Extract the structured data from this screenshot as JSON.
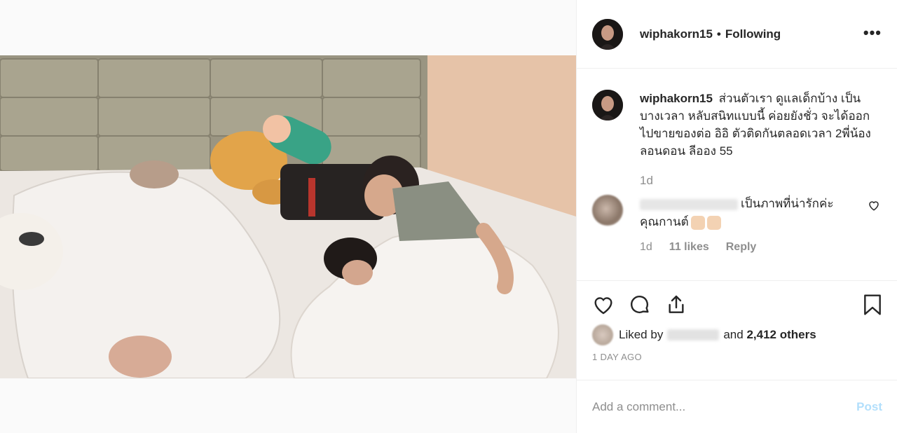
{
  "post": {
    "username": "wiphakorn15",
    "follow_status": "Following",
    "more_icon": "more-options-icon"
  },
  "caption": {
    "username": "wiphakorn15",
    "text": "ส่วนตัวเรา ดูแลเด็กบ้าง เป็นบางเวลา หลับสนิทแบบนี้ ค่อยยังชั่ว จะได้ออกไปขายของต่อ อิอิ ตัวติดกันตลอดเวลา 2พี่น้อง ลอนดอน ลีออง 55",
    "time": "1d"
  },
  "comment": {
    "text": "เป็นภาพที่น่ารักค่ะ คุณกานต์",
    "time": "1d",
    "likes": "11 likes",
    "reply_label": "Reply"
  },
  "actions": {
    "like_icon": "heart-icon",
    "comment_icon": "comment-icon",
    "share_icon": "share-icon",
    "save_icon": "bookmark-icon"
  },
  "likes": {
    "prefix": "Liked by",
    "suffix_and": "and",
    "others": "2,412 others"
  },
  "date_label": "1 DAY AGO",
  "add_comment": {
    "placeholder": "Add a comment...",
    "post_label": "Post"
  },
  "colors": {
    "text": "#262626",
    "muted": "#8e8e8e",
    "post_disabled": "#b2dffc",
    "border": "#efefef"
  }
}
